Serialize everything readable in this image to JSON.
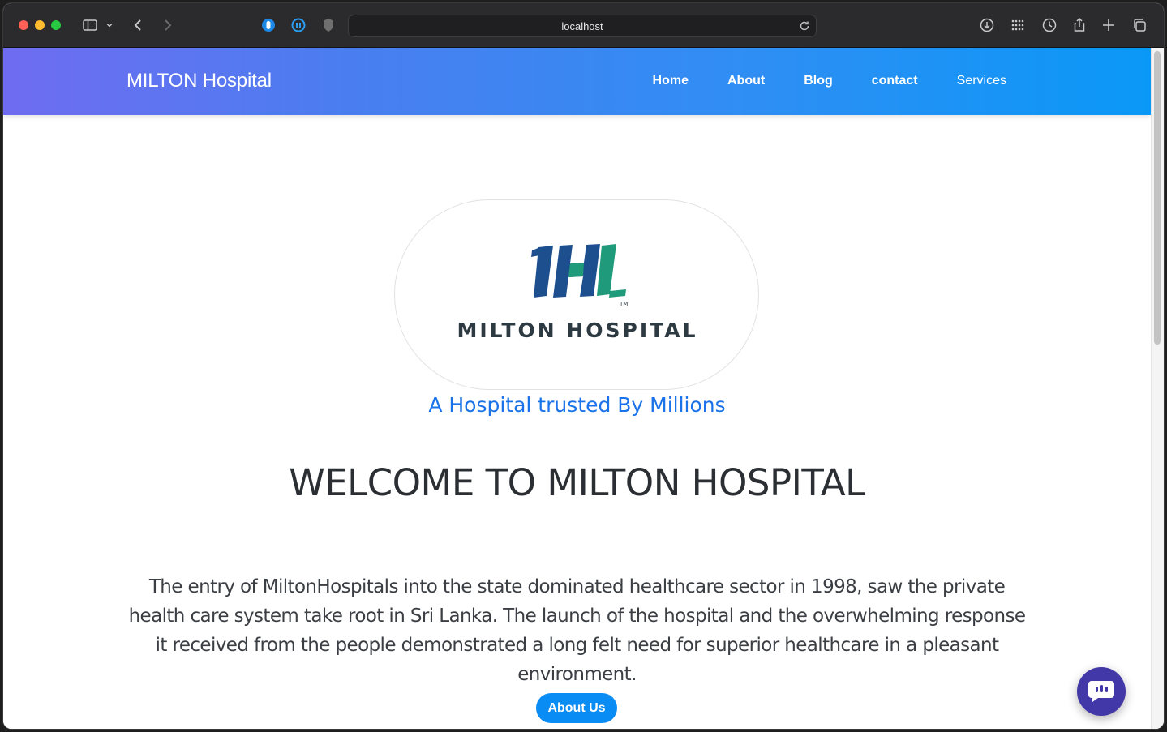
{
  "browser": {
    "url": "localhost",
    "icons": [
      "sidebar-icon",
      "chevron-down-icon",
      "back-icon",
      "forward-icon",
      "extension-icon",
      "pause-icon",
      "shield-icon",
      "reload-icon",
      "download-icon",
      "grid-icon",
      "clock-icon",
      "share-icon",
      "plus-icon",
      "tabs-icon"
    ]
  },
  "navbar": {
    "brand": "MILTON Hospital",
    "links": [
      {
        "label": "Home"
      },
      {
        "label": "About"
      },
      {
        "label": "Blog"
      },
      {
        "label": "contact"
      },
      {
        "label": "Services"
      }
    ]
  },
  "hero": {
    "logo_text": "MILTON HOSPITAL",
    "logo_tm": "TM",
    "tagline": "A Hospital trusted By Millions",
    "heading": "WELCOME TO MILTON HOSPITAL",
    "intro": "The entry of MiltonHospitals into the state dominated healthcare sector in 1998, saw the private health care system take root in Sri Lanka. The launch of the hospital and the overwhelming response it received from the people demonstrated a long felt need for superior healthcare in a pleasant environment.",
    "button_label": "About Us"
  },
  "colors": {
    "accent": "#0a8cf5",
    "tagline": "#1a73e8",
    "logo_blue": "#1d4f8f",
    "logo_teal": "#1f9a7a",
    "chat": "#4338a8"
  }
}
